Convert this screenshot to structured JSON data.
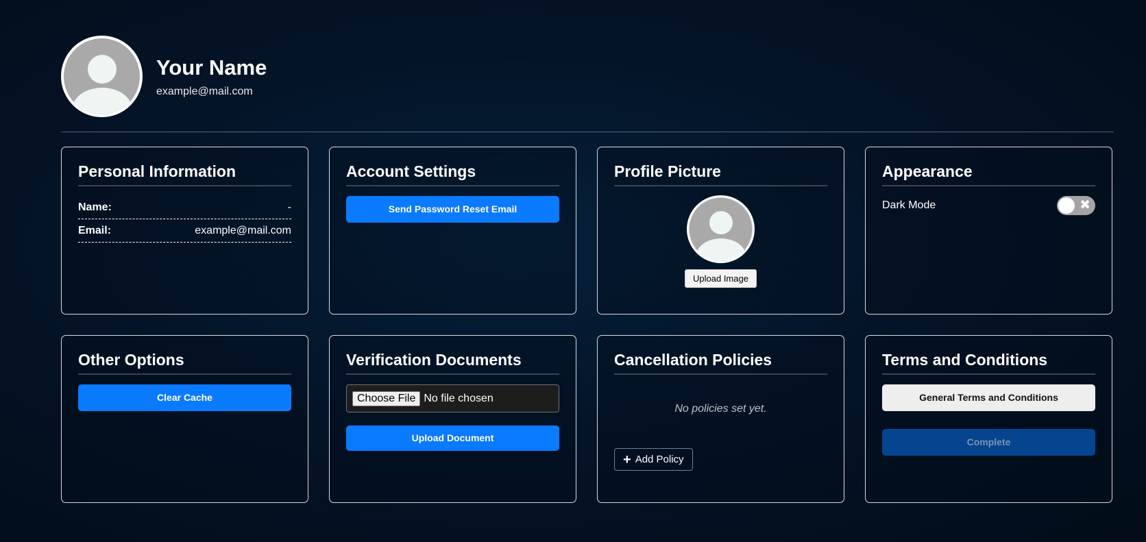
{
  "header": {
    "name": "Your Name",
    "email": "example@mail.com",
    "avatar_icon": "user-avatar-icon"
  },
  "cards": {
    "personal": {
      "title": "Personal Information",
      "rows": [
        {
          "label": "Name:",
          "value": "-"
        },
        {
          "label": "Email:",
          "value": "example@mail.com"
        }
      ]
    },
    "account": {
      "title": "Account Settings",
      "reset_button": "Send Password Reset Email"
    },
    "profile_picture": {
      "title": "Profile Picture",
      "upload_button": "Upload Image"
    },
    "appearance": {
      "title": "Appearance",
      "dark_mode_label": "Dark Mode",
      "dark_mode_enabled": false,
      "toggle_off_symbol": "✖"
    },
    "other": {
      "title": "Other Options",
      "clear_cache_button": "Clear Cache"
    },
    "verification": {
      "title": "Verification Documents",
      "choose_file_button": "Choose File",
      "file_status": "No file chosen",
      "upload_button": "Upload Document"
    },
    "cancellation": {
      "title": "Cancellation Policies",
      "empty_text": "No policies set yet.",
      "add_symbol": "+",
      "add_button": "Add Policy"
    },
    "terms": {
      "title": "Terms and Conditions",
      "general_button": "General Terms and Conditions",
      "complete_button": "Complete"
    }
  },
  "colors": {
    "primary_button": "#0a7aff",
    "disabled_button": "#05458f",
    "background": "#041428"
  }
}
